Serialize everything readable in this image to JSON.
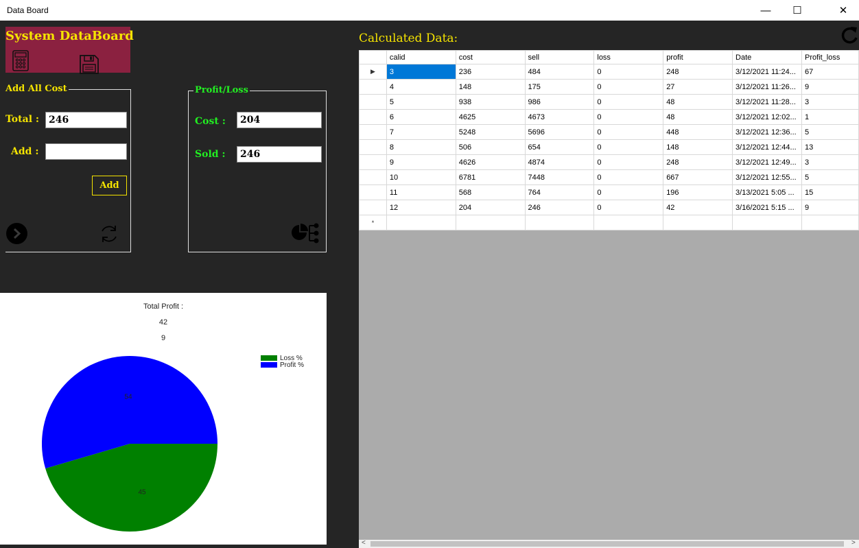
{
  "window": {
    "title": "Data Board",
    "min": "—",
    "max": "☐",
    "close": "✕"
  },
  "banner": {
    "title": "System DataBoard",
    "icons": [
      "calculator-icon",
      "floppy-save-icon"
    ],
    "color": "#8b2140"
  },
  "add_cost": {
    "legend": "Add All Cost",
    "total_label": "Total :",
    "total_value": "246",
    "add_label": "Add :",
    "add_value": "",
    "add_button": "Add",
    "icons": [
      "next-arrow-icon",
      "refresh-icon"
    ]
  },
  "profit_loss": {
    "legend": "Profit/Loss",
    "cost_label": "Cost :",
    "cost_value": "204",
    "sold_label": "Sold :",
    "sold_value": "246",
    "icons": [
      "pie-chart-icon"
    ]
  },
  "calculated_title": "Calculated Data:",
  "table": {
    "columns": [
      "calid",
      "cost",
      "sell",
      "loss",
      "profit",
      "Date",
      "Profit_loss"
    ],
    "rows": [
      [
        "3",
        "236",
        "484",
        "0",
        "248",
        "3/12/2021 11:24...",
        "67"
      ],
      [
        "4",
        "148",
        "175",
        "0",
        "27",
        "3/12/2021 11:26...",
        "9"
      ],
      [
        "5",
        "938",
        "986",
        "0",
        "48",
        "3/12/2021 11:28...",
        "3"
      ],
      [
        "6",
        "4625",
        "4673",
        "0",
        "48",
        "3/12/2021 12:02...",
        "1"
      ],
      [
        "7",
        "5248",
        "5696",
        "0",
        "448",
        "3/12/2021 12:36...",
        "5"
      ],
      [
        "8",
        "506",
        "654",
        "0",
        "148",
        "3/12/2021 12:44...",
        "13"
      ],
      [
        "9",
        "4626",
        "4874",
        "0",
        "248",
        "3/12/2021 12:49...",
        "3"
      ],
      [
        "10",
        "6781",
        "7448",
        "0",
        "667",
        "3/12/2021 12:55...",
        "5"
      ],
      [
        "11",
        "568",
        "764",
        "0",
        "196",
        "3/13/2021 5:05 ...",
        "15"
      ],
      [
        "12",
        "204",
        "246",
        "0",
        "42",
        "3/16/2021 5:15 ...",
        "9"
      ]
    ],
    "current_row_marker": "▶",
    "new_row_marker": "*"
  },
  "chart_data": {
    "type": "pie",
    "title": "Total Profit :",
    "subtitle_lines": [
      "42",
      "9"
    ],
    "slices": [
      {
        "name": "Loss %",
        "value": 45,
        "label": "45",
        "color": "#008000"
      },
      {
        "name": "Profit %",
        "value": 54,
        "label": "54",
        "color": "#0000ff"
      }
    ],
    "legend_position": "top-right"
  },
  "scrollbar": {
    "left_arrow": "<",
    "right_arrow": ">"
  }
}
